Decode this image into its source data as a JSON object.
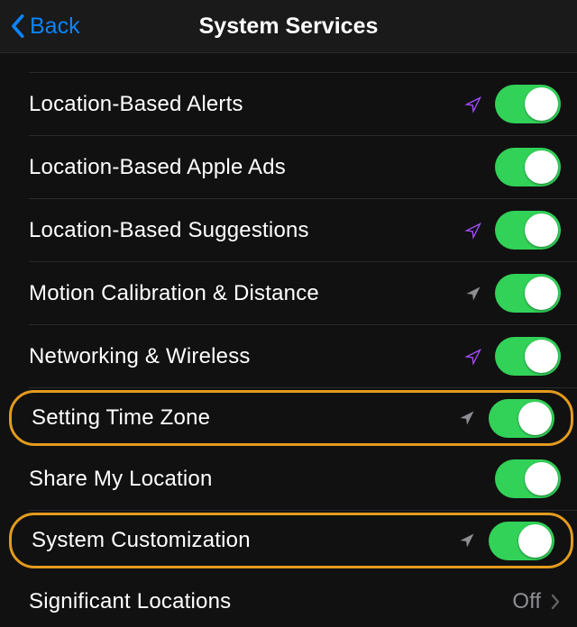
{
  "nav": {
    "back_label": "Back",
    "title": "System Services"
  },
  "rows": [
    {
      "label": "Location-Based Alerts",
      "arrow": "purple",
      "toggle": true,
      "highlight": false
    },
    {
      "label": "Location-Based Apple Ads",
      "arrow": null,
      "toggle": true,
      "highlight": false
    },
    {
      "label": "Location-Based Suggestions",
      "arrow": "purple",
      "toggle": true,
      "highlight": false
    },
    {
      "label": "Motion Calibration & Distance",
      "arrow": "gray",
      "toggle": true,
      "highlight": false
    },
    {
      "label": "Networking & Wireless",
      "arrow": "purple",
      "toggle": true,
      "highlight": false
    },
    {
      "label": "Setting Time Zone",
      "arrow": "gray",
      "toggle": true,
      "highlight": true
    },
    {
      "label": "Share My Location",
      "arrow": null,
      "toggle": true,
      "highlight": false
    },
    {
      "label": "System Customization",
      "arrow": "gray",
      "toggle": true,
      "highlight": true
    },
    {
      "label": "Significant Locations",
      "value": "Off",
      "disclosure": true
    }
  ]
}
